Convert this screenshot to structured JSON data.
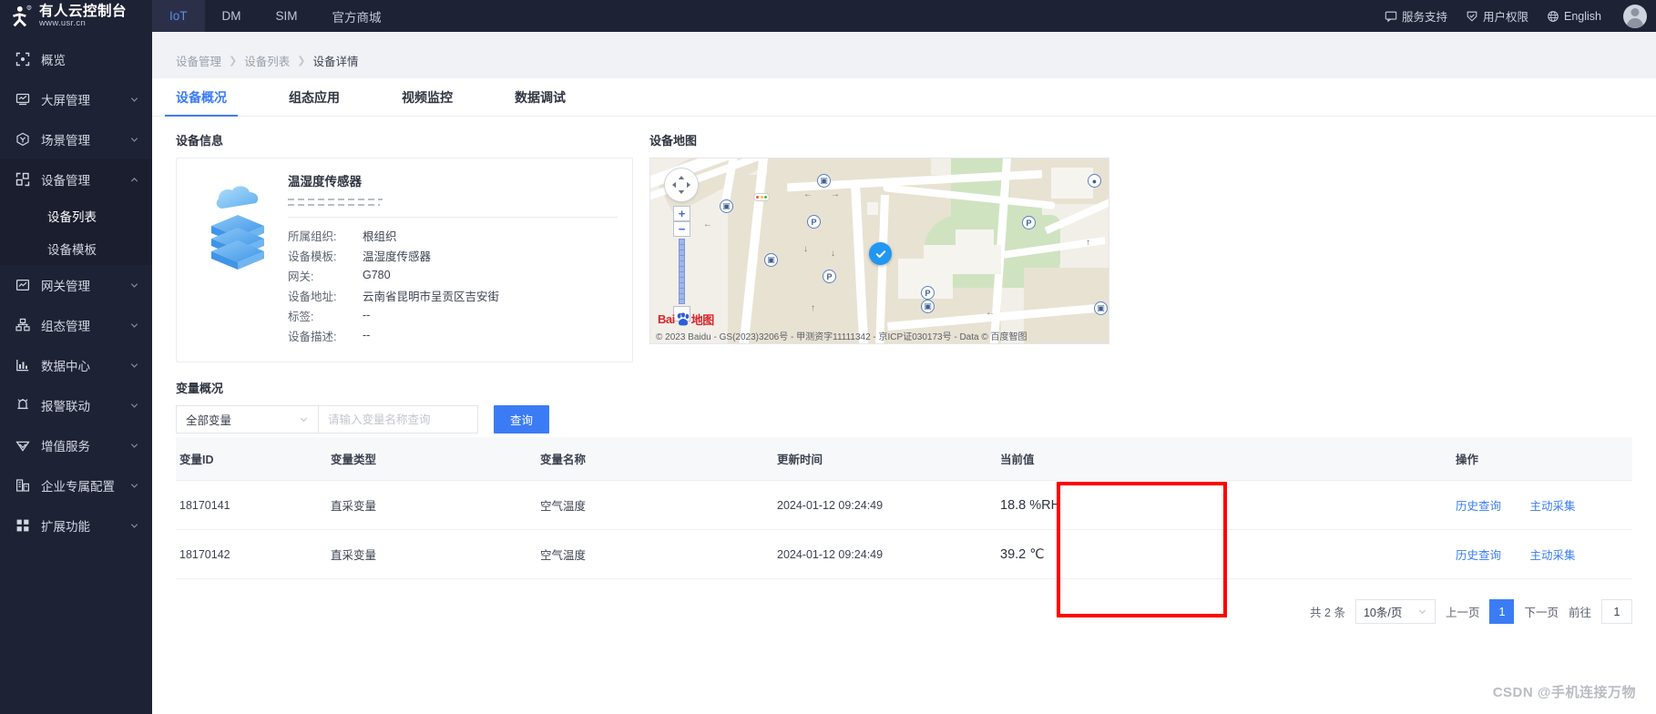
{
  "brand": {
    "name_cn": "有人云控制台",
    "url": "www.usr.cn"
  },
  "topnav": [
    {
      "label": "IoT",
      "active": true
    },
    {
      "label": "DM",
      "active": false
    },
    {
      "label": "SIM",
      "active": false
    },
    {
      "label": "官方商城",
      "active": false
    }
  ],
  "topright": [
    {
      "icon": "chat-icon",
      "label": "服务支持"
    },
    {
      "icon": "shield-icon",
      "label": "用户权限"
    },
    {
      "icon": "globe-icon",
      "label": "English"
    }
  ],
  "sidebar": [
    {
      "label": "概览",
      "icon": "overview-icon",
      "caret": false
    },
    {
      "label": "大屏管理",
      "icon": "screen-icon",
      "caret": true
    },
    {
      "label": "场景管理",
      "icon": "scene-icon",
      "caret": true
    },
    {
      "label": "设备管理",
      "icon": "device-icon",
      "caret": true,
      "expanded": true
    },
    {
      "label": "网关管理",
      "icon": "gateway-icon",
      "caret": true
    },
    {
      "label": "组态管理",
      "icon": "config-icon",
      "caret": true
    },
    {
      "label": "数据中心",
      "icon": "data-icon",
      "caret": true
    },
    {
      "label": "报警联动",
      "icon": "alarm-icon",
      "caret": true
    },
    {
      "label": "增值服务",
      "icon": "value-icon",
      "caret": true
    },
    {
      "label": "企业专属配置",
      "icon": "enterprise-icon",
      "caret": true
    },
    {
      "label": "扩展功能",
      "icon": "extension-icon",
      "caret": true
    }
  ],
  "sidebar_sub": [
    {
      "label": "设备列表",
      "active": true
    },
    {
      "label": "设备模板",
      "active": false
    }
  ],
  "breadcrumb": [
    {
      "label": "设备管理",
      "current": false
    },
    {
      "label": "设备列表",
      "current": false
    },
    {
      "label": "设备详情",
      "current": true
    }
  ],
  "tabs": [
    {
      "label": "设备概况",
      "active": true
    },
    {
      "label": "组态应用",
      "active": false
    },
    {
      "label": "视频监控",
      "active": false
    },
    {
      "label": "数据调试",
      "active": false
    }
  ],
  "device_info": {
    "section_title": "设备信息",
    "name": "温湿度传感器",
    "rows": [
      {
        "key": "所属组织:",
        "value": "根组织"
      },
      {
        "key": "设备模板:",
        "value": "温湿度传感器"
      },
      {
        "key": "网关:",
        "value": "G780"
      },
      {
        "key": "设备地址:",
        "value": "云南省昆明市呈贡区吉安街"
      },
      {
        "key": "标签:",
        "value": "--"
      },
      {
        "key": "设备描述:",
        "value": "--"
      }
    ]
  },
  "map": {
    "section_title": "设备地图",
    "logo_text": "Bai",
    "logo_text2": "地图",
    "attribution": "© 2023 Baidu - GS(2023)3206号 - 甲测资字11111342 - 京ICP证030173号 - Data © 百度智图"
  },
  "variables": {
    "section_title": "变量概况",
    "filter_select": "全部变量",
    "search_placeholder": "请输入变量名称查询",
    "search_value": "",
    "query_button": "查询",
    "columns": [
      "变量ID",
      "变量类型",
      "变量名称",
      "更新时间",
      "当前值",
      "操作"
    ],
    "rows": [
      {
        "id": "18170141",
        "type": "直采变量",
        "name": "空气温度",
        "updated": "2024-01-12 09:24:49",
        "value": "18.8 %RH",
        "actions": [
          "历史查询",
          "主动采集"
        ]
      },
      {
        "id": "18170142",
        "type": "直采变量",
        "name": "空气温度",
        "updated": "2024-01-12 09:24:49",
        "value": "39.2 ℃",
        "actions": [
          "历史查询",
          "主动采集"
        ]
      }
    ]
  },
  "pagination": {
    "total_text": "共 2 条",
    "page_size": "10条/页",
    "prev": "上一页",
    "current_page": "1",
    "next": "下一页",
    "goto_label": "前往",
    "goto_value": "1"
  },
  "watermark": "CSDN @手机连接万物",
  "colors": {
    "accent": "#3b7cf5",
    "highlight": "#ff0000",
    "sidebar_bg": "#1e2235"
  }
}
